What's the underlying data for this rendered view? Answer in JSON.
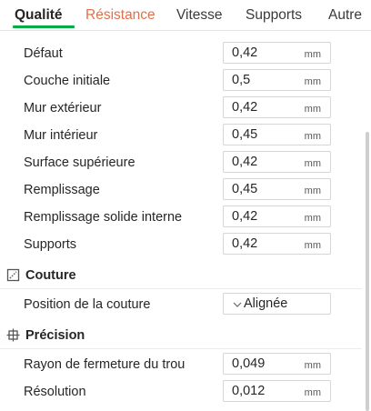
{
  "tabs": [
    {
      "label": "Qualité",
      "state": "active"
    },
    {
      "label": "Résistance",
      "state": "hover"
    },
    {
      "label": "Vitesse",
      "state": "normal"
    },
    {
      "label": "Supports",
      "state": "normal"
    },
    {
      "label": "Autre",
      "state": "normal"
    }
  ],
  "layer_width": {
    "rows": [
      {
        "label": "Défaut",
        "value": "0,42",
        "unit": "mm"
      },
      {
        "label": "Couche initiale",
        "value": "0,5",
        "unit": "mm"
      },
      {
        "label": "Mur extérieur",
        "value": "0,42",
        "unit": "mm"
      },
      {
        "label": "Mur intérieur",
        "value": "0,45",
        "unit": "mm"
      },
      {
        "label": "Surface supérieure",
        "value": "0,42",
        "unit": "mm"
      },
      {
        "label": "Remplissage",
        "value": "0,45",
        "unit": "mm"
      },
      {
        "label": "Remplissage solide interne",
        "value": "0,42",
        "unit": "mm"
      },
      {
        "label": "Supports",
        "value": "0,42",
        "unit": "mm"
      }
    ]
  },
  "seam": {
    "title": "Couture",
    "icon": "seam-icon",
    "position_label": "Position de la couture",
    "position_value": "Alignée"
  },
  "precision": {
    "title": "Précision",
    "icon": "precision-icon",
    "rows": [
      {
        "label": "Rayon de fermeture du trou",
        "value": "0,049",
        "unit": "mm"
      },
      {
        "label": "Résolution",
        "value": "0,012",
        "unit": "mm"
      }
    ]
  },
  "colors": {
    "accent": "#00ae42",
    "tab_hover": "#e0704a",
    "text": "#262626",
    "field_border": "#d6d6d6"
  }
}
